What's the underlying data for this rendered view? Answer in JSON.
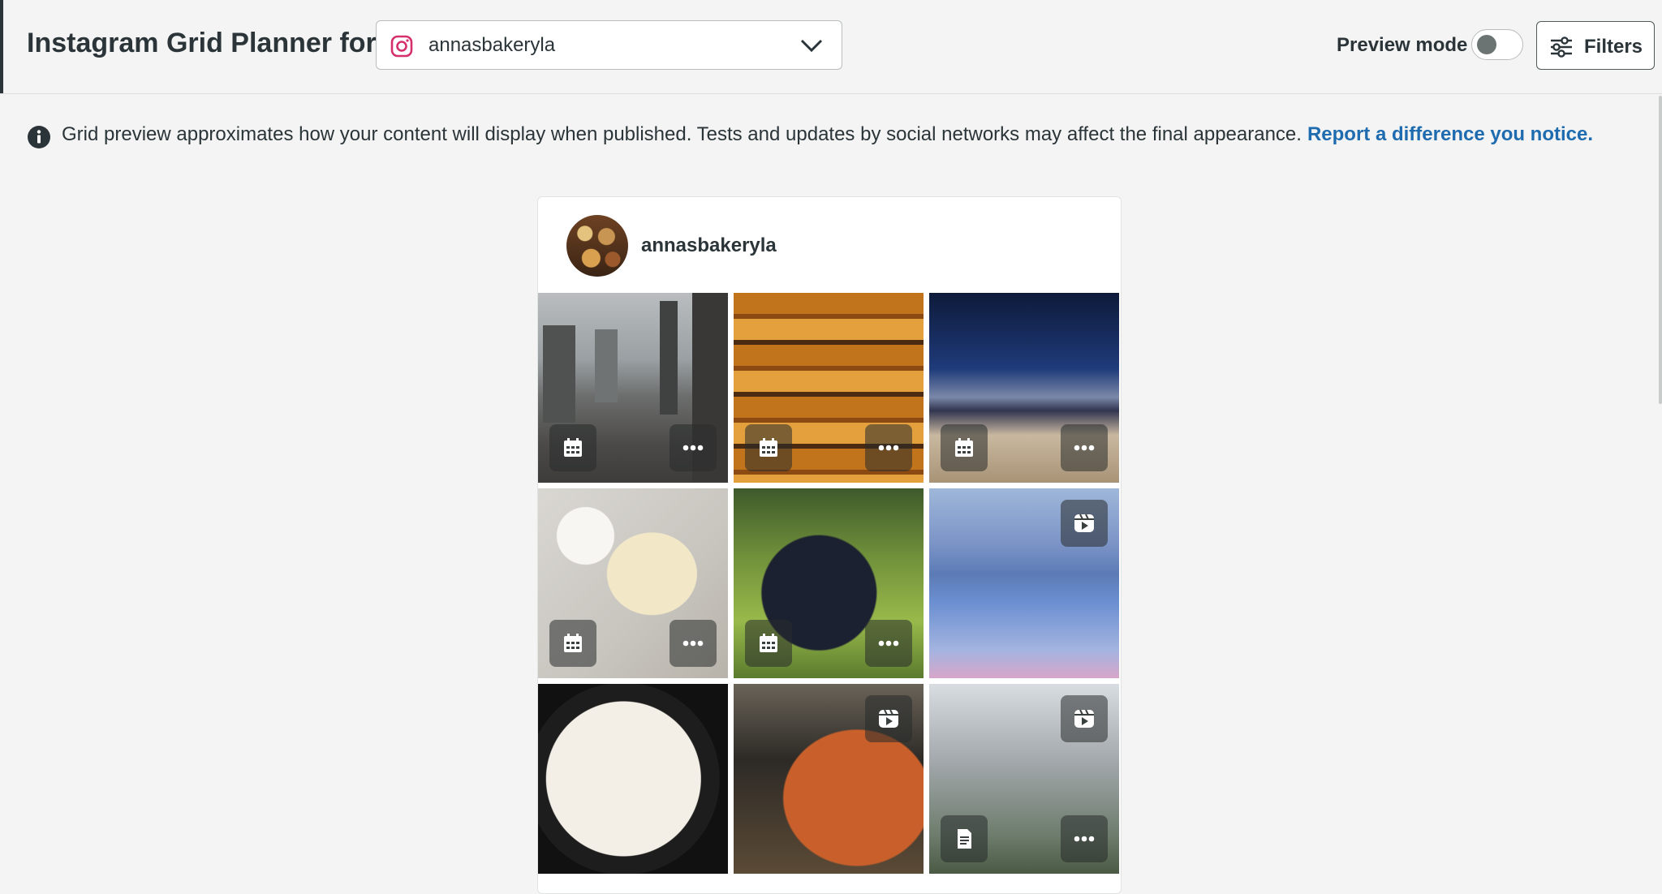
{
  "header": {
    "title": "Instagram Grid Planner for",
    "account": {
      "name": "annasbakeryla",
      "network_icon": "instagram-icon"
    },
    "preview_mode": {
      "label": "Preview mode",
      "enabled": false
    },
    "filters": {
      "label": "Filters",
      "icon": "sliders-icon"
    }
  },
  "info": {
    "text": "Grid preview approximates how your content will display when published. Tests and updates by social networks may affect the final appearance.",
    "link": "Report a difference you notice."
  },
  "profile": {
    "username": "annasbakeryla"
  },
  "grid": {
    "tiles": [
      {
        "subject": "city-street",
        "badges": [
          "calendar-icon",
          "more-icon"
        ]
      },
      {
        "subject": "bread-shelves",
        "badges": [
          "calendar-icon",
          "more-icon"
        ]
      },
      {
        "subject": "beach-night",
        "badges": [
          "calendar-icon",
          "more-icon"
        ]
      },
      {
        "subject": "cheese-board",
        "badges": [
          "calendar-icon",
          "more-icon"
        ]
      },
      {
        "subject": "grapes",
        "badges": [
          "calendar-icon",
          "more-icon"
        ]
      },
      {
        "subject": "lake-swan",
        "badges": [
          "reel-icon"
        ]
      },
      {
        "subject": "vinyl-record",
        "badges": []
      },
      {
        "subject": "pizza",
        "badges": [
          "reel-icon"
        ]
      },
      {
        "subject": "city-towers",
        "badges": [
          "reel-icon",
          "document-icon",
          "more-icon"
        ]
      }
    ]
  },
  "colors": {
    "accent_link": "#1f6bb0",
    "instagram": "#d6306c",
    "page_bg": "#f3f4f3"
  }
}
